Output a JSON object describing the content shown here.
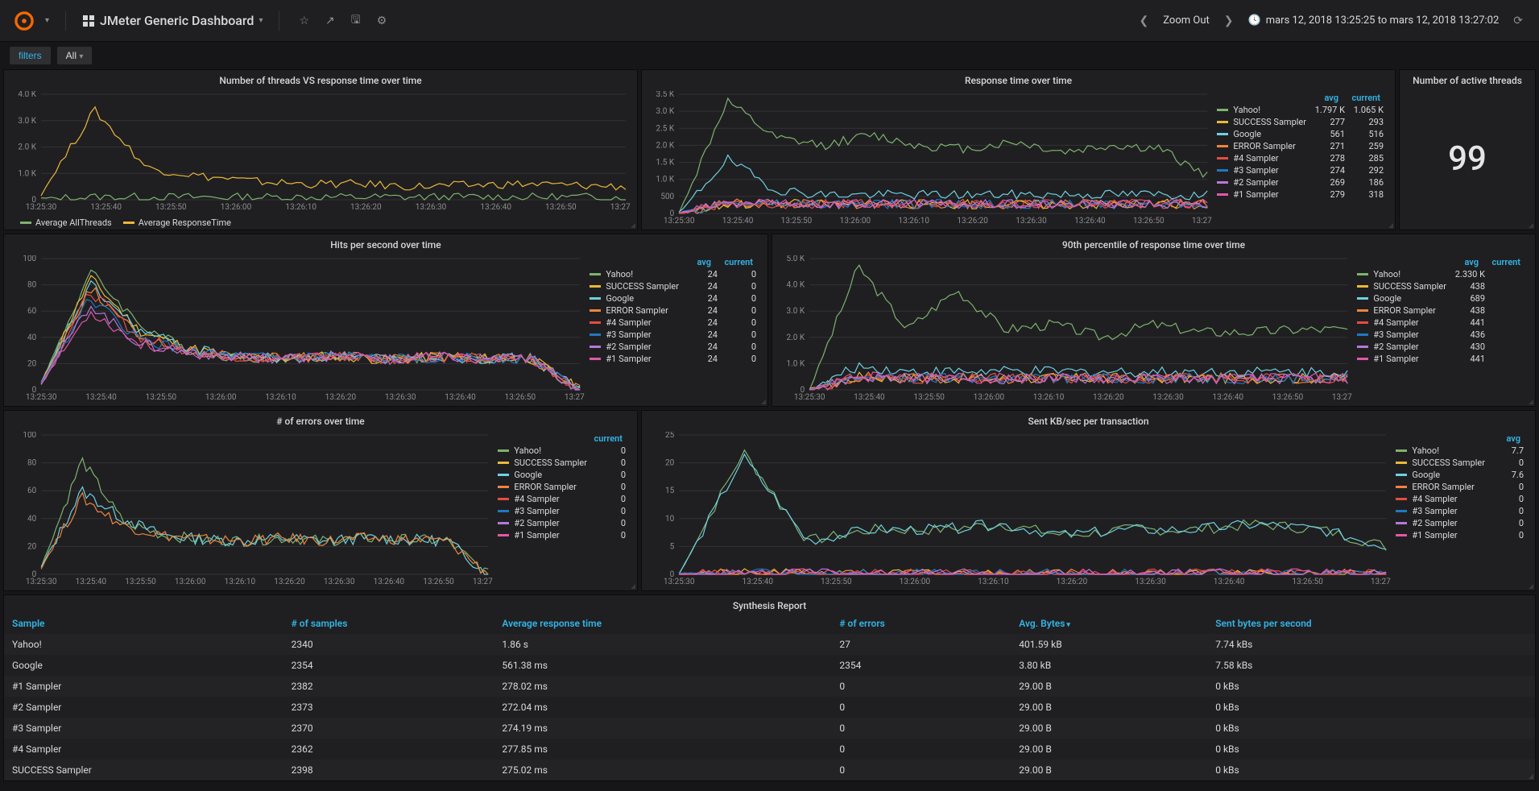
{
  "nav": {
    "dashboard_title": "JMeter Generic Dashboard",
    "zoom_out": "Zoom Out",
    "time_range": "mars 12, 2018 13:25:25 to mars 12, 2018 13:27:02"
  },
  "toolbar": {
    "filters_btn": "filters",
    "all_btn": "All"
  },
  "series_colors": {
    "Yahoo!": "#7eb26d",
    "SUCCESS Sampler": "#eab839",
    "Google": "#6ed0e0",
    "ERROR Sampler": "#ef843c",
    "#4 Sampler": "#e24d42",
    "#3 Sampler": "#1f78c1",
    "#2 Sampler": "#b877d9",
    "#1 Sampler": "#e356a7",
    "Average AllThreads": "#7eb26d",
    "Average ResponseTime": "#eab839"
  },
  "x_ticks": [
    "13:25:30",
    "13:25:40",
    "13:25:50",
    "13:26:00",
    "13:26:10",
    "13:26:20",
    "13:26:30",
    "13:26:40",
    "13:26:50",
    "13:27:00"
  ],
  "panels": {
    "threads_vs_rt": {
      "title": "Number of threads VS response time over time",
      "y_ticks": [
        "0",
        "1.0 K",
        "2.0 K",
        "3.0 K",
        "4.0 K"
      ],
      "legend": [
        "Average AllThreads",
        "Average ResponseTime"
      ]
    },
    "rt_over_time": {
      "title": "Response time over time",
      "y_ticks": [
        "0",
        "500",
        "1.0 K",
        "1.5 K",
        "2.0 K",
        "2.5 K",
        "3.0 K",
        "3.5 K"
      ],
      "headers": [
        "avg",
        "current"
      ],
      "rows": [
        {
          "name": "Yahoo!",
          "avg": "1.797 K",
          "current": "1.065 K"
        },
        {
          "name": "SUCCESS Sampler",
          "avg": "277",
          "current": "293"
        },
        {
          "name": "Google",
          "avg": "561",
          "current": "516"
        },
        {
          "name": "ERROR Sampler",
          "avg": "271",
          "current": "259"
        },
        {
          "name": "#4 Sampler",
          "avg": "278",
          "current": "285"
        },
        {
          "name": "#3 Sampler",
          "avg": "274",
          "current": "292"
        },
        {
          "name": "#2 Sampler",
          "avg": "269",
          "current": "186"
        },
        {
          "name": "#1 Sampler",
          "avg": "279",
          "current": "318"
        }
      ]
    },
    "active_threads": {
      "title": "Number of active threads",
      "value": "99"
    },
    "hits": {
      "title": "Hits per second over time",
      "y_ticks": [
        "0",
        "20",
        "40",
        "60",
        "80",
        "100"
      ],
      "headers": [
        "avg",
        "current"
      ],
      "rows": [
        {
          "name": "Yahoo!",
          "avg": "24",
          "current": "0"
        },
        {
          "name": "SUCCESS Sampler",
          "avg": "24",
          "current": "0"
        },
        {
          "name": "Google",
          "avg": "24",
          "current": "0"
        },
        {
          "name": "ERROR Sampler",
          "avg": "24",
          "current": "0"
        },
        {
          "name": "#4 Sampler",
          "avg": "24",
          "current": "0"
        },
        {
          "name": "#3 Sampler",
          "avg": "24",
          "current": "0"
        },
        {
          "name": "#2 Sampler",
          "avg": "24",
          "current": "0"
        },
        {
          "name": "#1 Sampler",
          "avg": "24",
          "current": "0"
        }
      ]
    },
    "p90": {
      "title": "90th percentile of response time over time",
      "y_ticks": [
        "0",
        "1.0 K",
        "2.0 K",
        "3.0 K",
        "4.0 K",
        "5.0 K"
      ],
      "headers": [
        "avg",
        "current"
      ],
      "rows": [
        {
          "name": "Yahoo!",
          "avg": "2.330 K",
          "current": ""
        },
        {
          "name": "SUCCESS Sampler",
          "avg": "438",
          "current": ""
        },
        {
          "name": "Google",
          "avg": "689",
          "current": ""
        },
        {
          "name": "ERROR Sampler",
          "avg": "438",
          "current": ""
        },
        {
          "name": "#4 Sampler",
          "avg": "441",
          "current": ""
        },
        {
          "name": "#3 Sampler",
          "avg": "436",
          "current": ""
        },
        {
          "name": "#2 Sampler",
          "avg": "430",
          "current": ""
        },
        {
          "name": "#1 Sampler",
          "avg": "441",
          "current": ""
        }
      ]
    },
    "errors": {
      "title": "# of errors over time",
      "y_ticks": [
        "0",
        "20",
        "40",
        "60",
        "80",
        "100"
      ],
      "headers": [
        "current"
      ],
      "rows": [
        {
          "name": "Yahoo!",
          "current": "0"
        },
        {
          "name": "SUCCESS Sampler",
          "current": "0"
        },
        {
          "name": "Google",
          "current": "0"
        },
        {
          "name": "ERROR Sampler",
          "current": "0"
        },
        {
          "name": "#4 Sampler",
          "current": "0"
        },
        {
          "name": "#3 Sampler",
          "current": "0"
        },
        {
          "name": "#2 Sampler",
          "current": "0"
        },
        {
          "name": "#1 Sampler",
          "current": "0"
        }
      ]
    },
    "sent_kb": {
      "title": "Sent KB/sec per transaction",
      "y_ticks": [
        "0",
        "5",
        "10",
        "15",
        "20",
        "25"
      ],
      "headers": [
        "avg"
      ],
      "rows": [
        {
          "name": "Yahoo!",
          "avg": "7.7"
        },
        {
          "name": "SUCCESS Sampler",
          "avg": "0"
        },
        {
          "name": "Google",
          "avg": "7.6"
        },
        {
          "name": "ERROR Sampler",
          "avg": "0"
        },
        {
          "name": "#4 Sampler",
          "avg": "0"
        },
        {
          "name": "#3 Sampler",
          "avg": "0"
        },
        {
          "name": "#2 Sampler",
          "avg": "0"
        },
        {
          "name": "#1 Sampler",
          "avg": "0"
        }
      ]
    },
    "synthesis": {
      "title": "Synthesis Report",
      "columns": [
        "Sample",
        "# of samples",
        "Average response time",
        "# of errors",
        "Avg. Bytes",
        "Sent bytes per second"
      ],
      "sort_col": 4,
      "rows": [
        [
          "Yahoo!",
          "2340",
          "1.86 s",
          "27",
          "401.59 kB",
          "7.74 kBs"
        ],
        [
          "Google",
          "2354",
          "561.38 ms",
          "2354",
          "3.80 kB",
          "7.58 kBs"
        ],
        [
          "#1 Sampler",
          "2382",
          "278.02 ms",
          "0",
          "29.00 B",
          "0 kBs"
        ],
        [
          "#2 Sampler",
          "2373",
          "272.04 ms",
          "0",
          "29.00 B",
          "0 kBs"
        ],
        [
          "#3 Sampler",
          "2370",
          "274.19 ms",
          "0",
          "29.00 B",
          "0 kBs"
        ],
        [
          "#4 Sampler",
          "2362",
          "277.85 ms",
          "0",
          "29.00 B",
          "0 kBs"
        ],
        [
          "SUCCESS Sampler",
          "2398",
          "275.02 ms",
          "0",
          "29.00 B",
          "0 kBs"
        ]
      ]
    }
  },
  "chart_data": [
    {
      "panel": "threads_vs_rt",
      "type": "line",
      "x_range_seconds": [
        0,
        100
      ],
      "ylim": [
        0,
        4000
      ],
      "series": [
        {
          "name": "Average AllThreads",
          "approx_values": [
            50,
            100,
            100,
            100,
            100,
            100,
            100,
            100,
            100,
            100,
            100,
            100
          ]
        },
        {
          "name": "Average ResponseTime",
          "approx_values": [
            200,
            3400,
            1200,
            900,
            700,
            600,
            600,
            500,
            550,
            600,
            550,
            500
          ]
        }
      ]
    },
    {
      "panel": "rt_over_time",
      "type": "line",
      "ylim": [
        0,
        3500
      ],
      "series": [
        {
          "name": "Yahoo!",
          "approx_values": [
            0,
            3300,
            2200,
            2000,
            2300,
            2000,
            1900,
            2100,
            1800,
            2000,
            1900,
            1100
          ]
        },
        {
          "name": "Google",
          "approx_values": [
            0,
            1600,
            700,
            550,
            550,
            550,
            550,
            550,
            560,
            560,
            560,
            520
          ]
        },
        {
          "name": "SUCCESS Sampler",
          "approx_values": [
            0,
            300,
            280,
            270,
            280,
            275,
            275,
            275,
            275,
            275,
            275,
            290
          ]
        },
        {
          "name": "ERROR Sampler",
          "approx_values": [
            0,
            300,
            280,
            270,
            270,
            270,
            270,
            270,
            270,
            270,
            270,
            260
          ]
        },
        {
          "name": "#4 Sampler",
          "approx_values": [
            0,
            300,
            280,
            278,
            278,
            278,
            278,
            278,
            278,
            278,
            278,
            285
          ]
        },
        {
          "name": "#3 Sampler",
          "approx_values": [
            0,
            300,
            280,
            274,
            274,
            274,
            274,
            274,
            274,
            274,
            274,
            292
          ]
        },
        {
          "name": "#2 Sampler",
          "approx_values": [
            0,
            300,
            280,
            269,
            269,
            269,
            269,
            269,
            269,
            269,
            269,
            186
          ]
        },
        {
          "name": "#1 Sampler",
          "approx_values": [
            0,
            300,
            280,
            279,
            279,
            279,
            279,
            279,
            279,
            279,
            279,
            318
          ]
        }
      ]
    },
    {
      "panel": "hits",
      "type": "line",
      "ylim": [
        0,
        100
      ],
      "series_note": "8 samplers oscillating ~24 after initial spike near 90",
      "series": [
        {
          "name": "Yahoo!",
          "approx_values": [
            5,
            90,
            50,
            30,
            25,
            24,
            26,
            23,
            25,
            24,
            24,
            0
          ]
        },
        {
          "name": "SUCCESS Sampler",
          "approx_values": [
            5,
            85,
            45,
            32,
            25,
            24,
            26,
            23,
            25,
            24,
            24,
            0
          ]
        },
        {
          "name": "Google",
          "approx_values": [
            5,
            80,
            45,
            32,
            25,
            24,
            26,
            23,
            25,
            24,
            24,
            0
          ]
        },
        {
          "name": "ERROR Sampler",
          "approx_values": [
            5,
            78,
            40,
            30,
            25,
            24,
            26,
            23,
            25,
            24,
            24,
            0
          ]
        },
        {
          "name": "#4 Sampler",
          "approx_values": [
            5,
            75,
            40,
            30,
            25,
            24,
            26,
            23,
            25,
            24,
            24,
            0
          ]
        },
        {
          "name": "#3 Sampler",
          "approx_values": [
            5,
            70,
            38,
            30,
            25,
            24,
            26,
            23,
            25,
            24,
            24,
            0
          ]
        },
        {
          "name": "#2 Sampler",
          "approx_values": [
            5,
            65,
            35,
            28,
            25,
            24,
            26,
            23,
            25,
            24,
            24,
            0
          ]
        },
        {
          "name": "#1 Sampler",
          "approx_values": [
            5,
            60,
            35,
            28,
            25,
            24,
            26,
            23,
            25,
            24,
            24,
            0
          ]
        }
      ]
    },
    {
      "panel": "p90",
      "type": "line",
      "ylim": [
        0,
        5000
      ],
      "series": [
        {
          "name": "Yahoo!",
          "approx_values": [
            0,
            4700,
            2300,
            3800,
            2300,
            2500,
            2000,
            2500,
            2200,
            2200,
            2300,
            2300
          ]
        },
        {
          "name": "Google",
          "approx_values": [
            0,
            900,
            700,
            700,
            700,
            700,
            690,
            690,
            690,
            690,
            690,
            690
          ]
        },
        {
          "name": "SUCCESS Sampler",
          "approx_values": [
            0,
            500,
            440,
            440,
            440,
            440,
            440,
            440,
            440,
            440,
            440,
            440
          ]
        },
        {
          "name": "ERROR Sampler",
          "approx_values": [
            0,
            500,
            440,
            440,
            440,
            440,
            440,
            440,
            440,
            440,
            440,
            440
          ]
        },
        {
          "name": "#4 Sampler",
          "approx_values": [
            0,
            500,
            440,
            440,
            440,
            440,
            440,
            440,
            440,
            440,
            440,
            440
          ]
        },
        {
          "name": "#3 Sampler",
          "approx_values": [
            0,
            500,
            436,
            436,
            436,
            436,
            436,
            436,
            436,
            436,
            436,
            436
          ]
        },
        {
          "name": "#2 Sampler",
          "approx_values": [
            0,
            500,
            430,
            430,
            430,
            430,
            430,
            430,
            430,
            430,
            430,
            430
          ]
        },
        {
          "name": "#1 Sampler",
          "approx_values": [
            0,
            500,
            441,
            441,
            441,
            441,
            441,
            441,
            441,
            441,
            441,
            441
          ]
        }
      ]
    },
    {
      "panel": "errors",
      "type": "line",
      "ylim": [
        0,
        100
      ],
      "series": [
        {
          "name": "Yahoo!",
          "approx_values": [
            5,
            82,
            38,
            28,
            25,
            24,
            26,
            24,
            26,
            25,
            24,
            0
          ]
        },
        {
          "name": "Google",
          "approx_values": [
            5,
            60,
            40,
            28,
            25,
            24,
            26,
            24,
            26,
            25,
            24,
            0
          ]
        },
        {
          "name": "ERROR Sampler",
          "approx_values": [
            5,
            55,
            35,
            28,
            25,
            24,
            26,
            24,
            26,
            25,
            24,
            0
          ]
        }
      ]
    },
    {
      "panel": "sent_kb",
      "type": "line",
      "ylim": [
        0,
        25
      ],
      "series": [
        {
          "name": "Yahoo!",
          "approx_values": [
            0,
            22,
            6,
            8,
            8,
            9,
            7,
            8,
            8,
            9,
            8,
            5
          ]
        },
        {
          "name": "Google",
          "approx_values": [
            0,
            21,
            6,
            8,
            8,
            9,
            7,
            8,
            8,
            9,
            8,
            5
          ]
        },
        {
          "name": "SUCCESS Sampler",
          "approx_values": [
            0,
            0,
            0,
            0,
            0,
            0,
            0,
            0,
            0,
            0,
            0,
            0
          ]
        },
        {
          "name": "ERROR Sampler",
          "approx_values": [
            0,
            0,
            0,
            0,
            0,
            0,
            0,
            0,
            0,
            0,
            0,
            0
          ]
        },
        {
          "name": "#4 Sampler",
          "approx_values": [
            0,
            0,
            0,
            0,
            0,
            0,
            0,
            0,
            0,
            0,
            0,
            0
          ]
        },
        {
          "name": "#3 Sampler",
          "approx_values": [
            0,
            0,
            0,
            0,
            0,
            0,
            0,
            0,
            0,
            0,
            0,
            0
          ]
        },
        {
          "name": "#2 Sampler",
          "approx_values": [
            0,
            0,
            0,
            0,
            0,
            0,
            0,
            0,
            0,
            0,
            0,
            0
          ]
        },
        {
          "name": "#1 Sampler",
          "approx_values": [
            0,
            0,
            0,
            0,
            0,
            0,
            0,
            0,
            0,
            0,
            0,
            0
          ]
        }
      ]
    }
  ]
}
